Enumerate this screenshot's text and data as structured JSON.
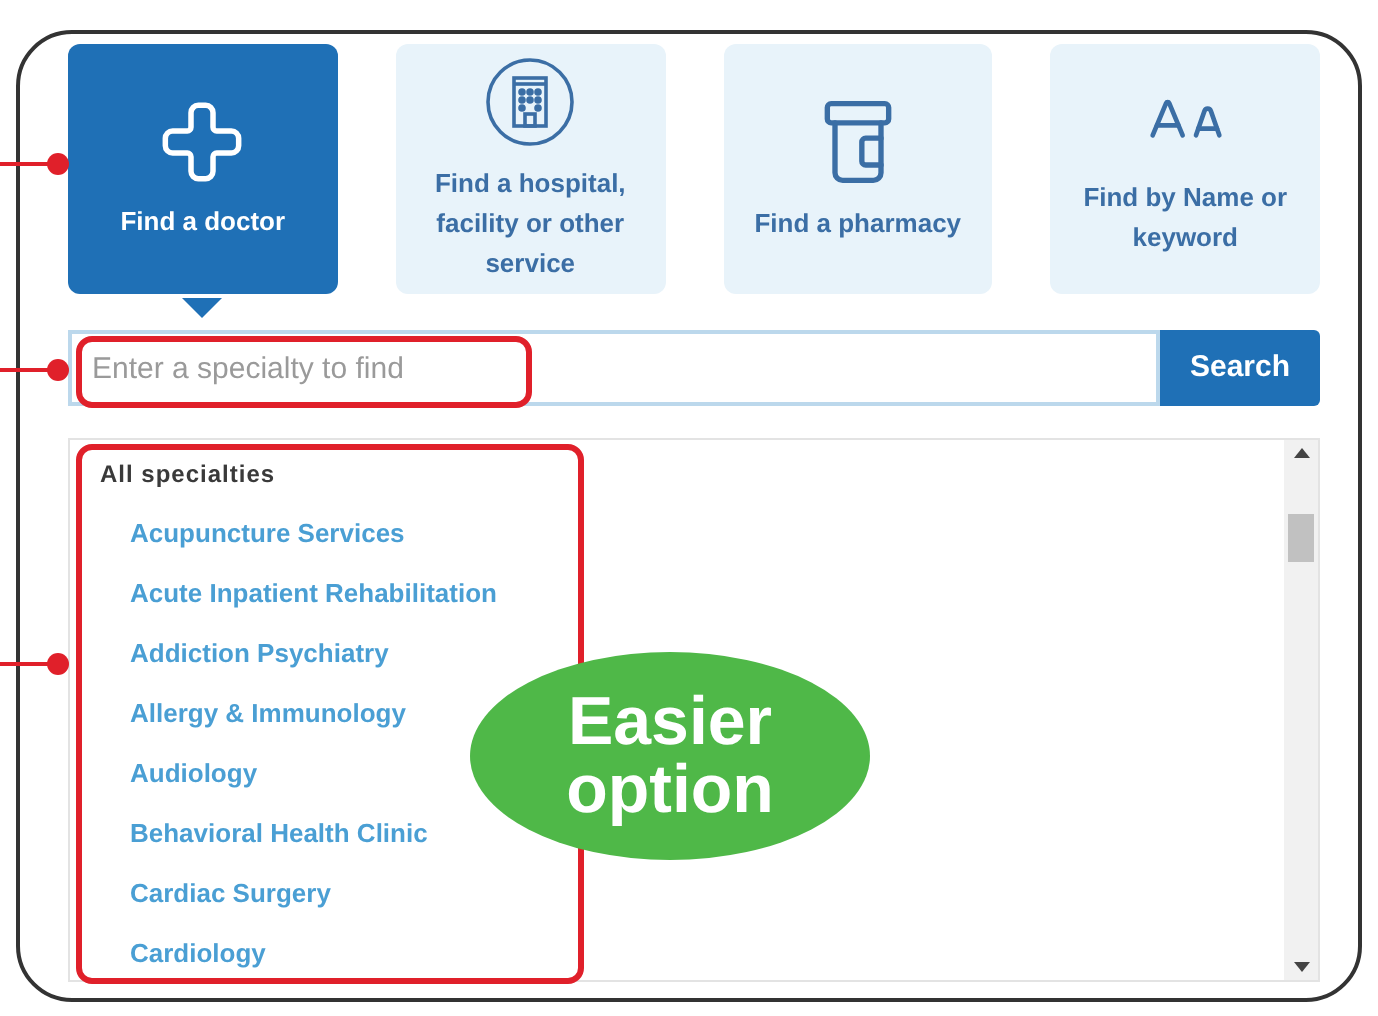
{
  "tiles": [
    {
      "kind": "doctor",
      "label": "Find a doctor",
      "selected": true
    },
    {
      "kind": "hospital",
      "label": "Find a hospital, facility or other service",
      "selected": false
    },
    {
      "kind": "pharmacy",
      "label": "Find a pharmacy",
      "selected": false
    },
    {
      "kind": "name",
      "label": "Find by Name or keyword",
      "selected": false
    }
  ],
  "search": {
    "placeholder": "Enter a specialty to find",
    "button": "Search"
  },
  "specialties": {
    "heading": "All specialties",
    "items": [
      "Acupuncture Services",
      "Acute Inpatient Rehabilitation",
      "Addiction Psychiatry",
      "Allergy & Immunology",
      "Audiology",
      "Behavioral Health Clinic",
      "Cardiac Surgery",
      "Cardiology"
    ]
  },
  "callout": {
    "lines": [
      "Easier",
      "option"
    ]
  }
}
